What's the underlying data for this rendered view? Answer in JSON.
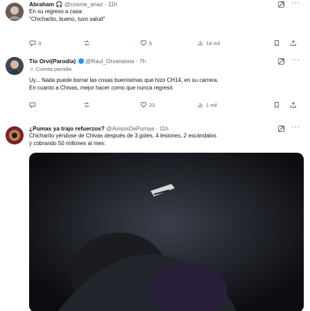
{
  "posts": [
    {
      "display_name": "Abraham 🎧",
      "handle": "@cosme_anaz",
      "separator": "·",
      "time": "11h",
      "text_line1": "En su regreso a casa:",
      "text_line2": "\"Chicharito, bueno, tuvo salud\"",
      "stats": {
        "replies": "3",
        "reposts": "",
        "likes": "5",
        "views": "14 mil"
      }
    },
    {
      "display_name": "Tío Orvi(Parodia)",
      "handle": "@Raul_Orvananos",
      "separator": "·",
      "time": "7h",
      "parody_label": "Cuenta parodia",
      "text_line1": "Uy... Nada puede borrar las cosas buenísimas que hizo CH14, en su carrera.",
      "text_line2": "En cuanto a Chivas, mejor hacer como que nunca regresó.",
      "stats": {
        "replies": "",
        "reposts": "",
        "likes": "23",
        "views": "1 mil"
      }
    },
    {
      "display_name": "¿Pumas ya trajo refuerzos?",
      "handle": "@AvisosDePumas",
      "separator": "·",
      "time": "11h",
      "text_line1": "Chicharito yéndose de Chivas después de 3 goles, 4 lesiones, 2 escándalos",
      "text_line2": "y cobrando 50 millones al mes:"
    }
  ],
  "icons": {
    "reply": "reply-icon",
    "repost": "repost-icon",
    "like": "heart-icon",
    "views": "views-chart-icon",
    "bookmark": "bookmark-icon",
    "share": "share-icon",
    "grok": "grok-icon",
    "more": "more-icon"
  },
  "colors": {
    "text": "#0f1419",
    "muted": "#536471",
    "verified": "#1d9bf0"
  }
}
